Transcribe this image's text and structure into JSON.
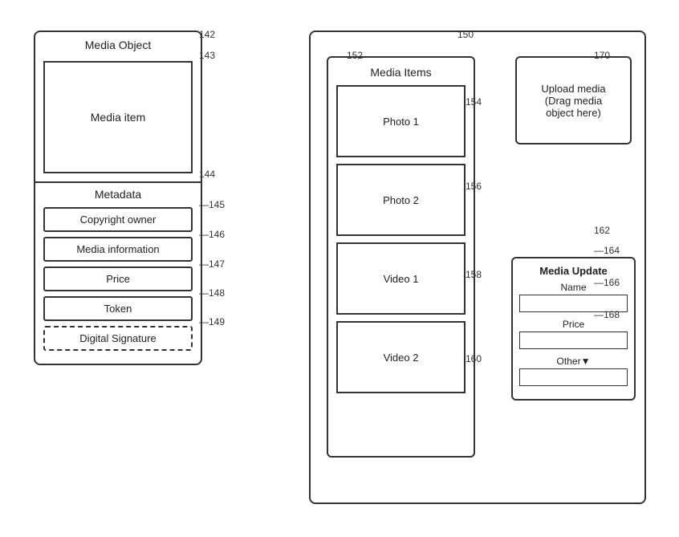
{
  "left_panel": {
    "ref_main": "142",
    "ref_inner": "143",
    "title": "Media Object",
    "media_item_label": "Media item",
    "metadata": {
      "ref": "144",
      "title": "Metadata",
      "items": [
        {
          "label": "Copyright owner",
          "ref": "145",
          "style": "solid"
        },
        {
          "label": "Media information",
          "ref": "146",
          "style": "solid"
        },
        {
          "label": "Price",
          "ref": "147",
          "style": "solid"
        },
        {
          "label": "Token",
          "ref": "148",
          "style": "solid"
        },
        {
          "label": "Digital Signature",
          "ref": "149",
          "style": "dashed"
        }
      ]
    }
  },
  "right_panel": {
    "ref_main": "150",
    "media_items": {
      "ref_box": "152",
      "title": "Media Items",
      "items": [
        {
          "label": "Photo 1",
          "ref": "154"
        },
        {
          "label": "Photo 2",
          "ref": "156"
        },
        {
          "label": "Video 1",
          "ref": "158"
        },
        {
          "label": "Video 2",
          "ref": "160"
        }
      ]
    },
    "upload_box": {
      "ref": "170",
      "line1": "Upload media",
      "line2": "(Drag media",
      "line3": "object here)"
    },
    "media_update": {
      "ref_box": "162",
      "title": "Media Update",
      "name_label": "Name",
      "name_ref": "164",
      "price_label": "Price",
      "price_ref": "166",
      "other_label": "Other",
      "other_ref": "168",
      "dropdown_arrow": "▼"
    }
  }
}
